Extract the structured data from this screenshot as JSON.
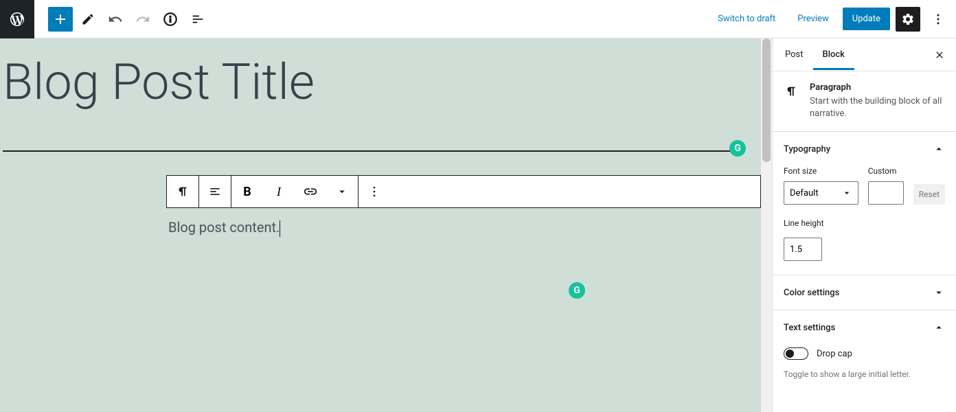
{
  "toolbar": {
    "switch_to_draft": "Switch to draft",
    "preview": "Preview",
    "update": "Update"
  },
  "editor": {
    "title": "Blog Post Title",
    "content": "Blog post content."
  },
  "sidebar": {
    "tabs": {
      "post": "Post",
      "block": "Block"
    },
    "paragraph": {
      "title": "Paragraph",
      "desc": "Start with the building block of all narrative."
    },
    "typography": {
      "title": "Typography",
      "font_size_label": "Font size",
      "custom_label": "Custom",
      "font_size_value": "Default",
      "reset": "Reset",
      "line_height_label": "Line height",
      "line_height_value": "1.5"
    },
    "color": {
      "title": "Color settings"
    },
    "text": {
      "title": "Text settings",
      "drop_cap": "Drop cap",
      "desc": "Toggle to show a large initial letter."
    }
  }
}
